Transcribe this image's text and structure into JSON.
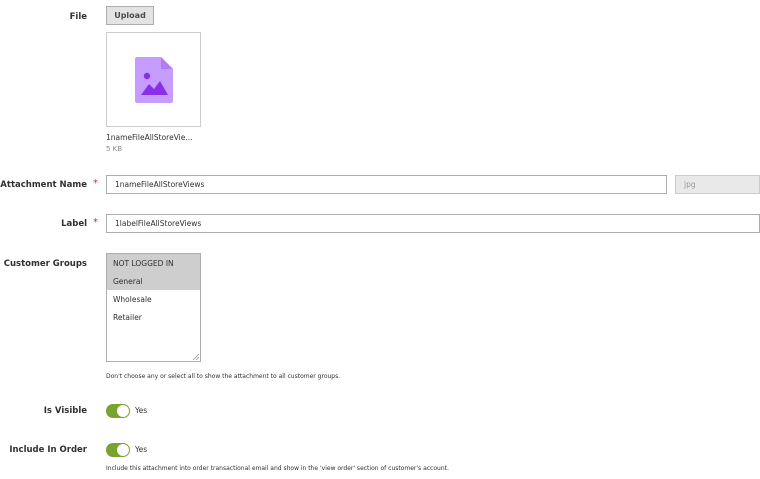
{
  "file": {
    "label": "File",
    "upload_button": "Upload",
    "preview_icon": "image-file-icon",
    "file_name": "1nameFileAllStoreVie...",
    "file_size": "5 KB"
  },
  "attachment_name": {
    "label": "Attachment Name",
    "required_mark": "*",
    "value": "1nameFileAllStoreViews",
    "extension": "jpg"
  },
  "label_field": {
    "label": "Label",
    "required_mark": "*",
    "value": "1labelFileAllStoreViews"
  },
  "customer_groups": {
    "label": "Customer Groups",
    "options": [
      {
        "label": "NOT LOGGED IN",
        "selected": true
      },
      {
        "label": "General",
        "selected": true
      },
      {
        "label": "Wholesale",
        "selected": false
      },
      {
        "label": "Retailer",
        "selected": false
      }
    ],
    "note": "Don't choose any or select all to show the attachment to all customer groups."
  },
  "is_visible": {
    "label": "Is Visible",
    "state_text": "Yes",
    "on": true
  },
  "include_in_order": {
    "label": "Include In Order",
    "state_text": "Yes",
    "on": true,
    "note": "Include this attachment into order transactional email and show in the 'view order' section of customer's account."
  },
  "colors": {
    "toggle_on": "#79a22e",
    "required": "#e22626",
    "icon": "#a855f7"
  }
}
